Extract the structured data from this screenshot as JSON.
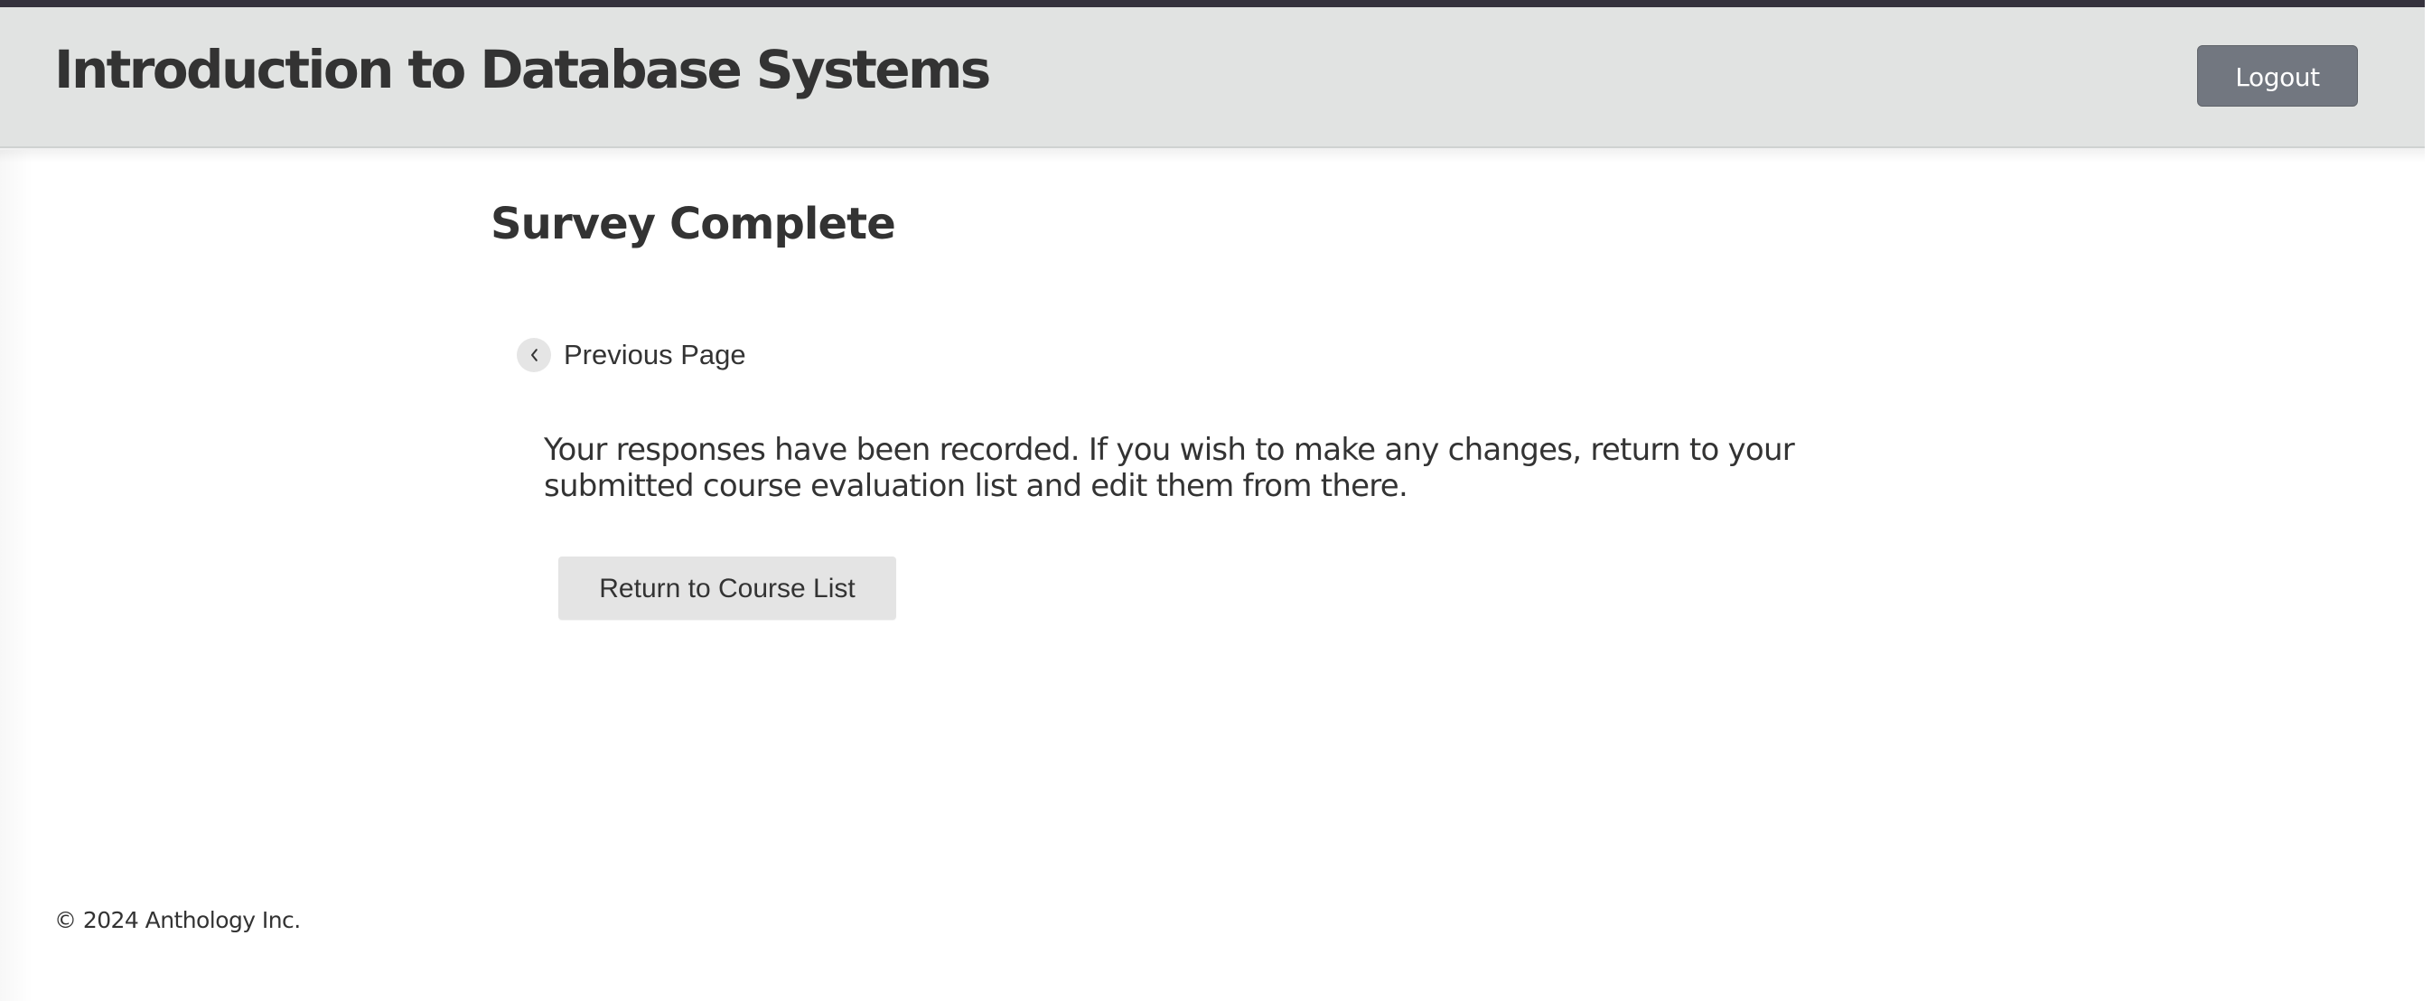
{
  "header": {
    "course_title": "Introduction to Database Systems",
    "logout_label": "Logout"
  },
  "main": {
    "page_title": "Survey Complete",
    "previous_page": {
      "icon": "chevron-left-icon",
      "label": "Previous Page"
    },
    "message": "Your responses have been recorded. If you wish to make any changes, return to your submitted course evaluation list and edit them from there.",
    "return_button_label": "Return to Course List"
  },
  "footer": {
    "copyright": "© 2024 Anthology Inc."
  },
  "colors": {
    "top_strip": "#35323d",
    "header_background": "#e1e3e2",
    "logout_button": "#727780",
    "secondary_button": "#e4e4e4",
    "text": "#333333"
  }
}
